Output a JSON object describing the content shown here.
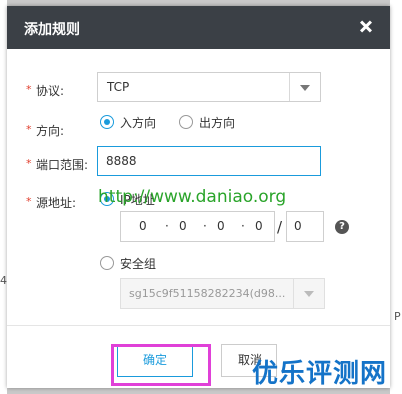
{
  "dialog": {
    "title": "添加规则",
    "close_icon": "close-icon"
  },
  "form": {
    "protocol": {
      "label": "协议:",
      "value": "TCP"
    },
    "direction": {
      "label": "方向:",
      "options": [
        "入方向",
        "出方向"
      ],
      "selected": "入方向"
    },
    "port_range": {
      "label": "端口范围:",
      "value": "8888"
    },
    "source": {
      "label": "源地址:",
      "ip_option": "IP地址",
      "ip_octets": [
        "0",
        "0",
        "0",
        "0"
      ],
      "separator": "/",
      "mask": "0",
      "help_icon": "?",
      "group_option": "安全组",
      "group_value": "sg15c9f51158282234(d98..."
    }
  },
  "buttons": {
    "ok": "确定",
    "cancel": "取消"
  },
  "watermark": "http://www.daniao.org",
  "brand": "优乐评测网",
  "background_edges": {
    "left": "4",
    "right": "P"
  },
  "colors": {
    "header": "#3b4046",
    "accent": "#1a9bdc",
    "required": "#e03e2d",
    "highlight": "#e040d8",
    "brand": "#1473c8"
  }
}
